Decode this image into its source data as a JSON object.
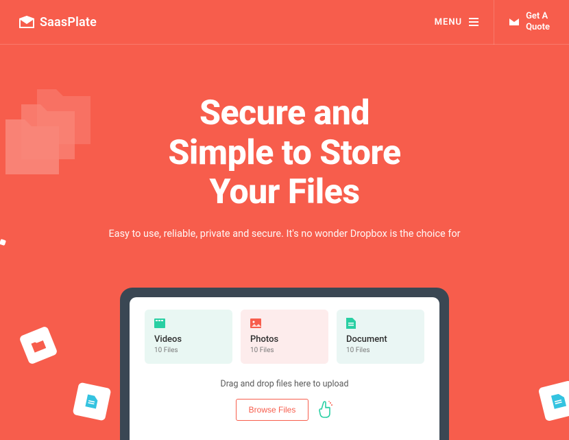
{
  "brand": {
    "name": "SaasPlate"
  },
  "header": {
    "menu_label": "MENU",
    "quote_label": "Get A\nQuote"
  },
  "hero": {
    "title_line1": "Secure and",
    "title_line2": "Simple to Store",
    "title_line3": "Your Files",
    "subtitle": "Easy to use, reliable, private and secure. It's no wonder Dropbox is the choice for"
  },
  "upload": {
    "cards": [
      {
        "title": "Videos",
        "count": "10 Files",
        "icon": "video-icon",
        "color": "#29cfa3"
      },
      {
        "title": "Photos",
        "count": "10 Files",
        "icon": "photo-icon",
        "color": "#f75d4c"
      },
      {
        "title": "Document",
        "count": "10 Files",
        "icon": "document-icon",
        "color": "#29cfa3"
      }
    ],
    "drop_text": "Drag and drop files here to upload",
    "browse_label": "Browse Files"
  },
  "icons": {
    "logo": "envelope-open-icon",
    "menu": "hamburger-icon",
    "quote": "envelope-icon",
    "hand": "hand-pointer-icon",
    "folders": "folders-stack-icon"
  }
}
